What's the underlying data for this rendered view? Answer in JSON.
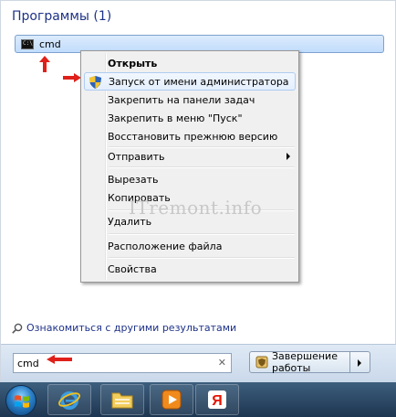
{
  "programs": {
    "header": "Программы (1)",
    "result_label": "cmd",
    "result_icon": "cmd-icon"
  },
  "context_menu": {
    "items": [
      {
        "label": "Открыть",
        "bold": true
      },
      {
        "label": "Запуск от имени администратора",
        "icon": "shield-icon",
        "highlighted": true
      },
      {
        "label": "Закрепить на панели задач"
      },
      {
        "label": "Закрепить в меню \"Пуск\""
      },
      {
        "label": "Восстановить прежнюю версию"
      },
      {
        "label": "Отправить",
        "submenu": true
      },
      {
        "label": "Вырезать"
      },
      {
        "label": "Копировать"
      },
      {
        "label": "Удалить"
      },
      {
        "label": "Расположение файла"
      },
      {
        "label": "Свойства"
      }
    ]
  },
  "watermark": "ITremont.info",
  "more_results": "Ознакомиться с другими результатами",
  "search": {
    "value": "cmd",
    "clear_icon": "clear-icon"
  },
  "shutdown": {
    "label": "Завершение работы"
  },
  "taskbar": {
    "items": [
      "start-orb",
      "internet-explorer-icon",
      "file-explorer-icon",
      "media-player-icon",
      "yandex-browser-icon"
    ]
  },
  "colors": {
    "accent": "#1e3287",
    "highlight": "#c1dcfc",
    "arrow": "#e0201a"
  }
}
